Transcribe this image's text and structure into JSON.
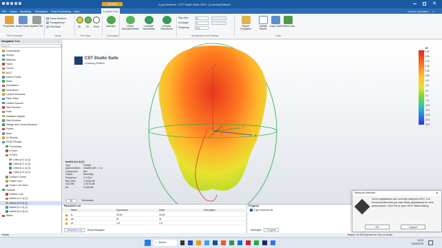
{
  "titlebar": {
    "title": "4.ghz Antenna - CST Studio Suite 2023 - [Learning Edition]",
    "context_tab": "Far-field",
    "window_controls": [
      "minimize-icon",
      "restore-icon",
      "close-icon"
    ]
  },
  "menu": {
    "tabs": [
      "File",
      "Home",
      "Modeling",
      "Simulation",
      "Post-Processing",
      "View",
      "Farfield Plot"
    ],
    "active": "Farfield Plot",
    "right_label": "Search Quickfind"
  },
  "ribbon": {
    "buttons": [
      {
        "label": "Properties",
        "icon": "gear-icon",
        "color": "#e0a33a"
      },
      {
        "label": "Array Factor",
        "icon": "array-icon",
        "color": "#6b8fc8"
      },
      {
        "label": "Update Plot",
        "icon": "refresh-icon",
        "color": "#9b9b9b"
      },
      {
        "label": "Isotropic",
        "icon": "sphere-icon",
        "color": "#4aa84a"
      },
      {
        "label": "Linear Omnidirectional",
        "icon": "sphere-icon",
        "color": "#58b558"
      },
      {
        "label": "Ludwig2 Directional",
        "icon": "sphere-icon",
        "color": "#3a9a5a"
      },
      {
        "label": "Circular Directional",
        "icon": "sphere-icon",
        "color": "#3a9a5a"
      },
      {
        "label": "Report Templates",
        "icon": "report-icon",
        "color": "#e0b24a"
      },
      {
        "label": "Update Result",
        "icon": "chart-icon",
        "color": "#5a8fc8"
      },
      {
        "label": "Copy Size",
        "icon": "copy-icon",
        "color": "#5a8fc8"
      },
      {
        "label": "Farfield Calc",
        "icon": "calc-icon",
        "color": "#4a9a4a"
      }
    ],
    "options": [
      "Show Structure",
      "Transparency",
      "Plot Mode"
    ],
    "plot_type": [
      "3D",
      "2D",
      "Polar"
    ],
    "fields": [
      {
        "label": "Step Size",
        "value": "5"
      },
      {
        "label": "Cut Angle",
        "value": "0"
      },
      {
        "label": "Frequency",
        "value": "2.4"
      }
    ],
    "groups": [
      "Plot Properties",
      "Mode",
      "Plot Type",
      "Calculation",
      "Visualization and Scaling",
      "Tools"
    ]
  },
  "navigation": {
    "header": "Navigation Tree",
    "search_placeholder": "Search",
    "items": [
      {
        "label": "Components",
        "depth": 0
      },
      {
        "label": "Groups",
        "depth": 0
      },
      {
        "label": "Materials",
        "depth": 0
      },
      {
        "label": "Faces",
        "depth": 0
      },
      {
        "label": "Curves",
        "depth": 0
      },
      {
        "label": "WCS",
        "depth": 0
      },
      {
        "label": "Anchor Points",
        "depth": 0
      },
      {
        "label": "Wires",
        "depth": 0
      },
      {
        "label": "Annotations",
        "depth": 0
      },
      {
        "label": "Dimensions",
        "depth": 0
      },
      {
        "label": "Lumped Elements",
        "depth": 0
      },
      {
        "label": "Plane Wave",
        "depth": 0
      },
      {
        "label": "Farfield Sources",
        "depth": 0
      },
      {
        "label": "Field Sources",
        "depth": 0
      },
      {
        "label": "Ports",
        "depth": 0
      },
      {
        "label": "Excitation Signals",
        "depth": 0
      },
      {
        "label": "Field Monitors",
        "depth": 0
      },
      {
        "label": "Voltage and Current Monitors",
        "depth": 0
      },
      {
        "label": "Probes",
        "depth": 0
      },
      {
        "label": "Mesh",
        "depth": 0
      },
      {
        "label": "1D Results",
        "depth": 0
      },
      {
        "label": "2D/3D Results",
        "depth": 0
      },
      {
        "label": "Port Modes",
        "depth": 1
      },
      {
        "label": "E-Field",
        "depth": 1
      },
      {
        "label": "H-Field",
        "depth": 1
      },
      {
        "label": "e-field (f=2.4) [1]",
        "depth": 2
      },
      {
        "label": "h-field (f=2.4) [1]",
        "depth": 2
      },
      {
        "label": "e-field (f=2.4) [1]",
        "depth": 2
      },
      {
        "label": "h-field (f=2.4) [1]",
        "depth": 2
      },
      {
        "label": "Surface Current",
        "depth": 1
      },
      {
        "label": "Power Flow",
        "depth": 1
      },
      {
        "label": "Power Loss Dens.",
        "depth": 1
      },
      {
        "label": "Farfields",
        "depth": 0
      },
      {
        "label": "Farfield Cuts",
        "depth": 1
      },
      {
        "label": "farfield (f=2.4) [1]",
        "depth": 1
      },
      {
        "label": "farfield (f=2.4) [1]",
        "depth": 1,
        "selected": true
      },
      {
        "label": "farfield (f=2.4) [1]",
        "depth": 1
      },
      {
        "label": "farfield (f=2.4) [1]",
        "depth": 1
      },
      {
        "label": "Tables",
        "depth": 0
      }
    ]
  },
  "document_tab": "4.ghz Antenna",
  "logo": {
    "title": "CST Studio Suite",
    "subtitle": "Learning Edition"
  },
  "farfield_info": {
    "header": "farfield (f=2.4) [1]",
    "rows": [
      {
        "k": "Type",
        "v": "Farfield"
      },
      {
        "k": "Approximation",
        "v": "enabled (kR >> 1)"
      },
      {
        "k": "Component",
        "v": "Abs"
      },
      {
        "k": "Output",
        "v": "Directivity"
      },
      {
        "k": "Frequency",
        "v": "2.4 GHz"
      },
      {
        "k": "Rad. Effic.",
        "v": "-0.3230 dB"
      },
      {
        "k": "Tot. Effic.",
        "v": "-0.5723 dB"
      },
      {
        "k": "Dir.",
        "v": "5.348 dBi"
      }
    ]
  },
  "colorbar": {
    "unit": "dBi",
    "ticks": [
      "5.35",
      "4.55",
      "3.75",
      "2.95",
      "1.45",
      "0.65",
      "-0.5",
      "-1.8",
      "-3.1",
      "-6.7",
      "-7.5",
      "-15.0",
      "-22.4",
      "-24.6",
      "-29.2",
      "-30.5"
    ]
  },
  "axes": {
    "x": "x",
    "y": "y",
    "z": "z"
  },
  "view_tabs": [
    "3D",
    "Schematic"
  ],
  "params": {
    "title": "Parameter List",
    "columns": [
      "Name",
      "Expression",
      "Value",
      "Description"
    ],
    "rows": [
      {
        "name": "ls",
        "expr": "26.59",
        "value": "26.59",
        "desc": ""
      },
      {
        "name": "ws",
        "expr": "31",
        "value": "31",
        "desc": ""
      },
      {
        "name": "wf",
        "expr": "1.8",
        "value": "1.8",
        "desc": ""
      }
    ],
    "tabs": [
      "Parameter List",
      "Result Navigator"
    ]
  },
  "progress": {
    "title": "Progress",
    "item": "4.ghz Antenna.cst",
    "tabs": [
      "Messages",
      "Progress"
    ]
  },
  "notification": {
    "title": "Windows Defender",
    "text": "Some applications are currently using the GPU. It is recommended that you stop these applications for best performance. Click OK to open GPU Status Dialog.",
    "ok": "OK",
    "cancel": "Cancel"
  },
  "statusbar": {
    "left": "Ready",
    "right": "Raster=10.000  Normal  mm  GHz  ns  Kelvin"
  },
  "taskbar": {
    "search": "Search",
    "time": "10:24",
    "date": "12/05/2023"
  }
}
